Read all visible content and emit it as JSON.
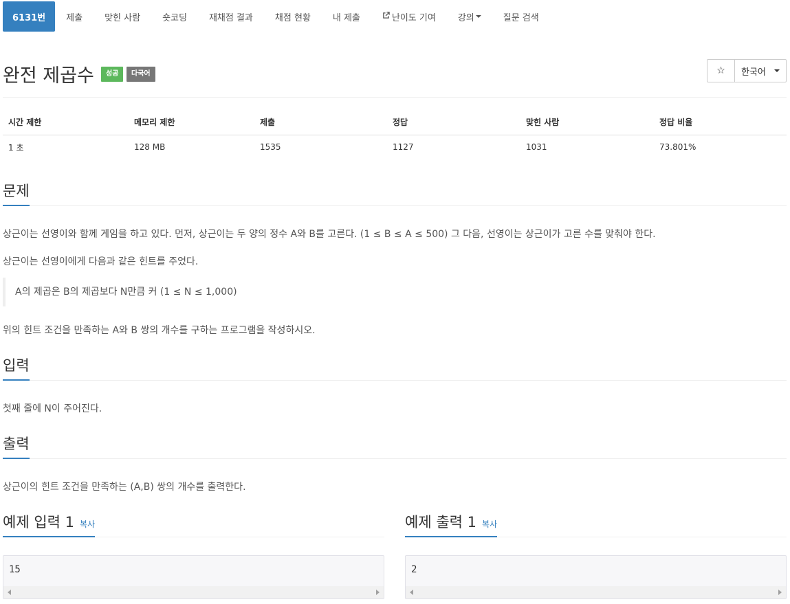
{
  "nav": {
    "items": [
      {
        "label": "6131번"
      },
      {
        "label": "제출"
      },
      {
        "label": "맞힌 사람"
      },
      {
        "label": "숏코딩"
      },
      {
        "label": "재채점 결과"
      },
      {
        "label": "채점 현황"
      },
      {
        "label": "내 제출"
      },
      {
        "label": "난이도 기여",
        "icon": "external-link-icon"
      },
      {
        "label": "강의",
        "icon": "caret-down-icon"
      },
      {
        "label": "질문 검색"
      }
    ]
  },
  "problem": {
    "title": "완전 제곱수",
    "badges": {
      "success": "성공",
      "multilang": "다국어"
    },
    "star_glyph": "☆",
    "language": "한국어"
  },
  "info_table": {
    "headers": [
      "시간 제한",
      "메모리 제한",
      "제출",
      "정답",
      "맞힌 사람",
      "정답 비율"
    ],
    "values": [
      "1 초",
      "128 MB",
      "1535",
      "1127",
      "1031",
      "73.801%"
    ]
  },
  "sections": {
    "problem_heading": "문제",
    "problem_p1": "상근이는 선영이와 함께 게임을 하고 있다. 먼저, 상근이는 두 양의 정수 A와 B를 고른다. (1 ≤ B ≤ A ≤ 500) 그 다음, 선영이는 상근이가 고른 수를 맞춰야 한다.",
    "problem_p2": "상근이는 선영이에게 다음과 같은 힌트를 주었다.",
    "problem_quote": "A의 제곱은 B의 제곱보다 N만큼 커 (1 ≤ N ≤ 1,000)",
    "problem_p3": "위의 힌트 조건을 만족하는 A와 B 쌍의 개수를 구하는 프로그램을 작성하시오.",
    "input_heading": "입력",
    "input_text": "첫째 줄에 N이 주어진다.",
    "output_heading": "출력",
    "output_text": "상근이의 힌트 조건을 만족하는 (A,B) 쌍의 개수를 출력한다.",
    "sample_input_heading": "예제 입력 1",
    "sample_output_heading": "예제 출력 1",
    "copy_label": "복사",
    "sample_input": "15",
    "sample_output": "2"
  },
  "colors": {
    "accent": "#3580bf",
    "success": "#5cb85c",
    "muted_badge": "#777777"
  }
}
